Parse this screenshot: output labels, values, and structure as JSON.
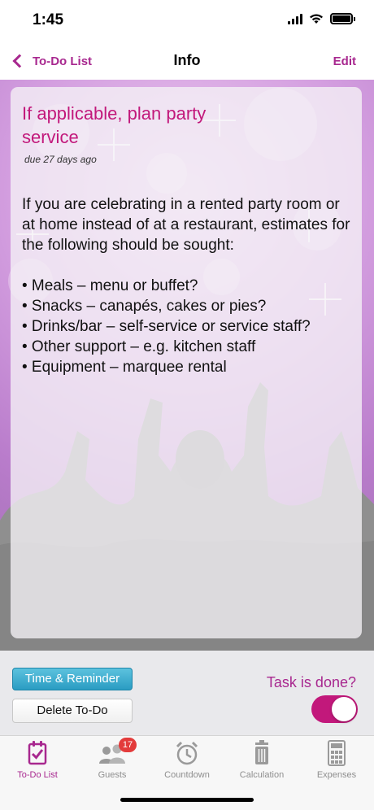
{
  "status": {
    "time": "1:45"
  },
  "nav": {
    "back_label": "To-Do List",
    "title": "Info",
    "edit_label": "Edit"
  },
  "task": {
    "title": "If applicable, plan party service",
    "due": "due  27 days ago",
    "description": "If you are celebrating in a rented party room or at home instead of at a restaurant, estimates for the following should be sought:\n\n• Meals – menu or buffet?\n• Snacks – canapés, cakes or pies?\n• Drinks/bar – self-service or service staff?\n• Other support – e.g. kitchen staff\n• Equipment – marquee rental"
  },
  "actions": {
    "time_reminder_label": "Time & Reminder",
    "delete_label": "Delete To-Do",
    "done_label": "Task is done?",
    "done": true
  },
  "tabs": [
    {
      "label": "To-Do List",
      "icon": "checklist-icon",
      "active": true
    },
    {
      "label": "Guests",
      "icon": "guests-icon",
      "badge": "17"
    },
    {
      "label": "Countdown",
      "icon": "alarm-clock-icon"
    },
    {
      "label": "Calculation",
      "icon": "trash-can-icon"
    },
    {
      "label": "Expenses",
      "icon": "calculator-icon"
    }
  ],
  "colors": {
    "accent": "#a8288f",
    "title": "#c2187b",
    "toggle_on": "#c2187b",
    "button_blue": "#2a9cc2",
    "badge": "#e33b3b"
  }
}
